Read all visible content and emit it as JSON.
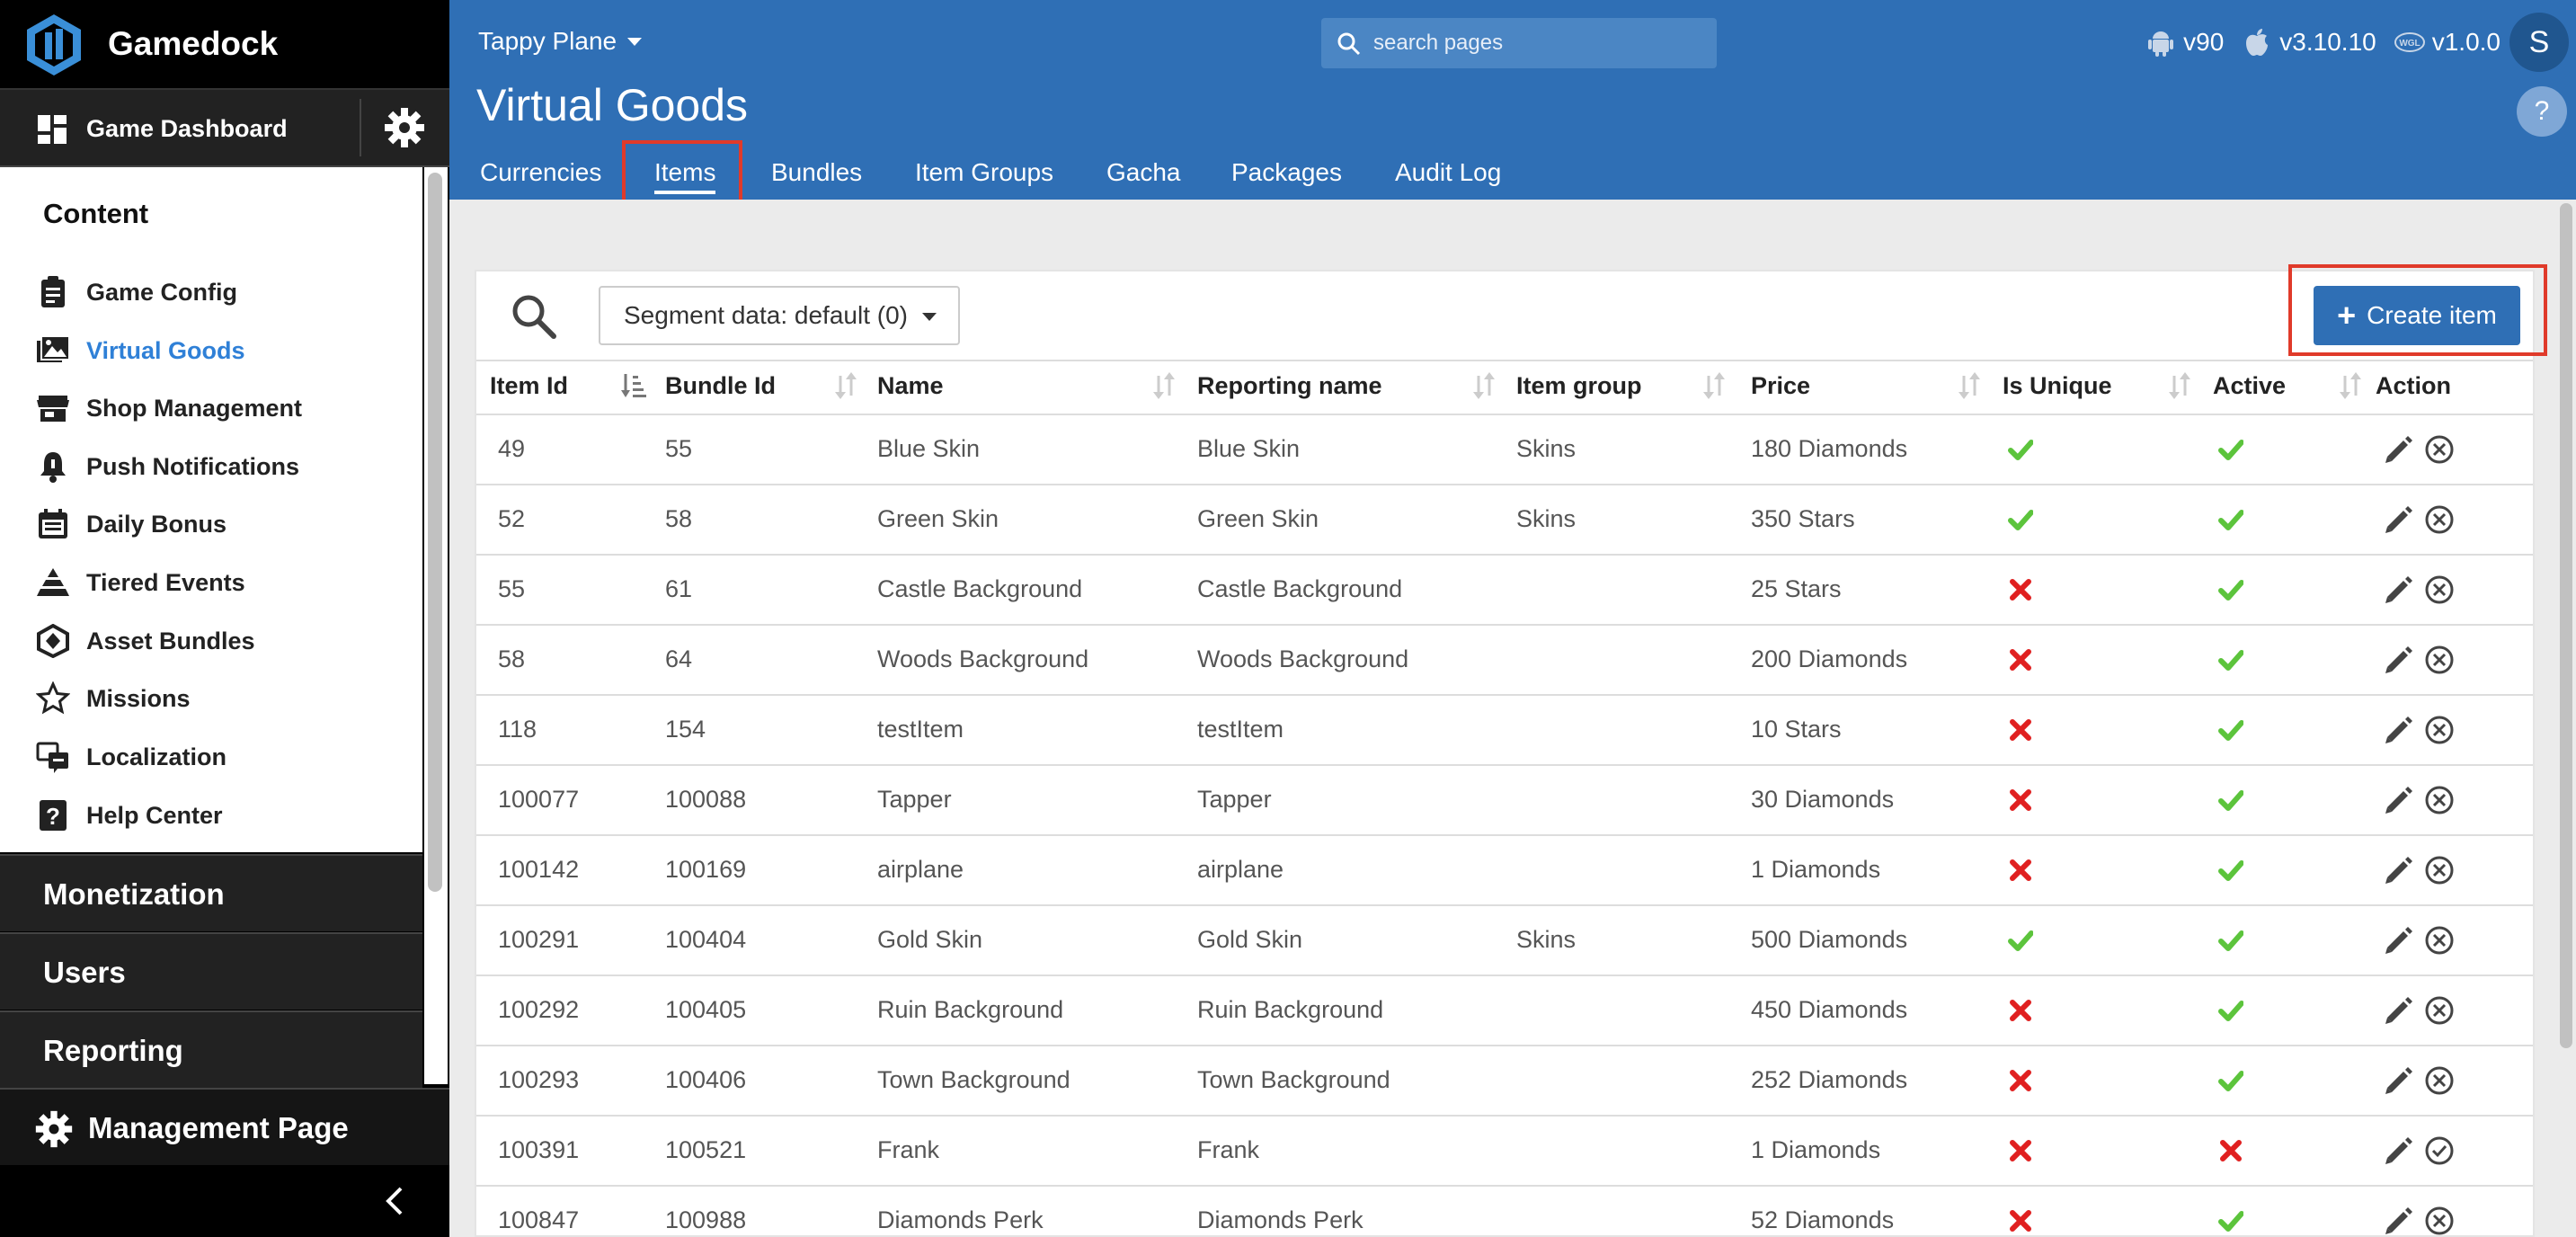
{
  "sidebar": {
    "brand": "Gamedock",
    "dashboard_label": "Game Dashboard",
    "content_title": "Content",
    "nav_items": [
      {
        "label": "Game Config",
        "icon": "clipboard-icon"
      },
      {
        "label": "Virtual Goods",
        "icon": "images-icon",
        "active": true
      },
      {
        "label": "Shop Management",
        "icon": "store-icon"
      },
      {
        "label": "Push Notifications",
        "icon": "bell-icon"
      },
      {
        "label": "Daily Bonus",
        "icon": "calendar-icon"
      },
      {
        "label": "Tiered Events",
        "icon": "pyramid-icon"
      },
      {
        "label": "Asset Bundles",
        "icon": "unity-icon"
      },
      {
        "label": "Missions",
        "icon": "star-icon"
      },
      {
        "label": "Localization",
        "icon": "language-icon"
      },
      {
        "label": "Help Center",
        "icon": "question-icon"
      }
    ],
    "sections": [
      "Monetization",
      "Users",
      "Reporting"
    ],
    "management_label": "Management Page"
  },
  "header": {
    "app_name": "Tappy Plane",
    "search_placeholder": "search pages",
    "android_version": "v90",
    "ios_version": "v3.10.10",
    "webgl_version": "v1.0.0",
    "avatar_letter": "S",
    "page_title": "Virtual Goods",
    "help_label": "?",
    "tabs": [
      "Currencies",
      "Items",
      "Bundles",
      "Item Groups",
      "Gacha",
      "Packages",
      "Audit Log"
    ],
    "active_tab": "Items"
  },
  "toolbar": {
    "segment_label": "Segment data: default (0)",
    "create_label": "Create item"
  },
  "table": {
    "columns": [
      "Item Id",
      "Bundle Id",
      "Name",
      "Reporting name",
      "Item group",
      "Price",
      "Is Unique",
      "Active",
      "Action"
    ],
    "rows": [
      {
        "item_id": "49",
        "bundle_id": "55",
        "name": "Blue Skin",
        "reporting_name": "Blue Skin",
        "item_group": "Skins",
        "price": "180 Diamonds",
        "is_unique": true,
        "active": true
      },
      {
        "item_id": "52",
        "bundle_id": "58",
        "name": "Green Skin",
        "reporting_name": "Green Skin",
        "item_group": "Skins",
        "price": "350 Stars",
        "is_unique": true,
        "active": true
      },
      {
        "item_id": "55",
        "bundle_id": "61",
        "name": "Castle Background",
        "reporting_name": "Castle Background",
        "item_group": "",
        "price": "25 Stars",
        "is_unique": false,
        "active": true
      },
      {
        "item_id": "58",
        "bundle_id": "64",
        "name": "Woods Background",
        "reporting_name": "Woods Background",
        "item_group": "",
        "price": "200 Diamonds",
        "is_unique": false,
        "active": true
      },
      {
        "item_id": "118",
        "bundle_id": "154",
        "name": "testItem",
        "reporting_name": "testItem",
        "item_group": "",
        "price": "10 Stars",
        "is_unique": false,
        "active": true
      },
      {
        "item_id": "100077",
        "bundle_id": "100088",
        "name": "Tapper",
        "reporting_name": "Tapper",
        "item_group": "",
        "price": "30 Diamonds",
        "is_unique": false,
        "active": true
      },
      {
        "item_id": "100142",
        "bundle_id": "100169",
        "name": "airplane",
        "reporting_name": "airplane",
        "item_group": "",
        "price": "1 Diamonds",
        "is_unique": false,
        "active": true
      },
      {
        "item_id": "100291",
        "bundle_id": "100404",
        "name": "Gold Skin",
        "reporting_name": "Gold Skin",
        "item_group": "Skins",
        "price": "500 Diamonds",
        "is_unique": true,
        "active": true
      },
      {
        "item_id": "100292",
        "bundle_id": "100405",
        "name": "Ruin Background",
        "reporting_name": "Ruin Background",
        "item_group": "",
        "price": "450 Diamonds",
        "is_unique": false,
        "active": true
      },
      {
        "item_id": "100293",
        "bundle_id": "100406",
        "name": "Town Background",
        "reporting_name": "Town Background",
        "item_group": "",
        "price": "252 Diamonds",
        "is_unique": false,
        "active": true
      },
      {
        "item_id": "100391",
        "bundle_id": "100521",
        "name": "Frank",
        "reporting_name": "Frank",
        "item_group": "",
        "price": "1 Diamonds",
        "is_unique": false,
        "active": false
      },
      {
        "item_id": "100847",
        "bundle_id": "100988",
        "name": "Diamonds Perk",
        "reporting_name": "Diamonds Perk",
        "item_group": "",
        "price": "52 Diamonds",
        "is_unique": false,
        "active": true
      }
    ]
  },
  "colors": {
    "header_blue": "#2f6fb5",
    "active_nav": "#2f80d7",
    "check_green": "#5cc43c",
    "cross_red": "#e02020",
    "highlight_red": "#e03a2a"
  }
}
